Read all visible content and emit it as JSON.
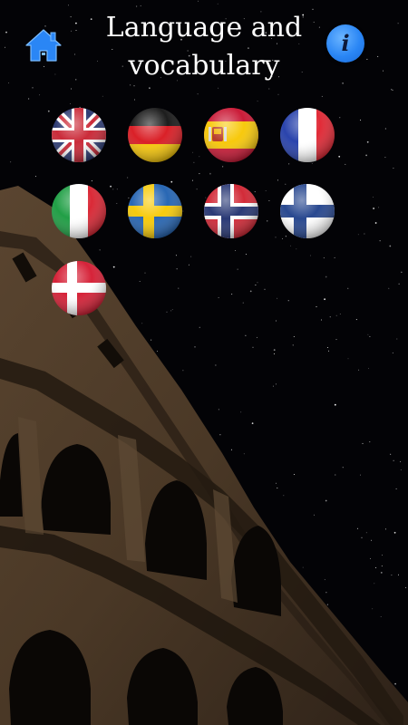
{
  "header": {
    "title": "Language and vocabulary",
    "title_line1": "Language and",
    "title_line2": "vocabulary",
    "home_icon": "home-icon",
    "info_icon": "info-icon",
    "info_glyph": "i",
    "accent_color": "#2a86f5"
  },
  "languages": [
    {
      "flag": "united-kingdom"
    },
    {
      "flag": "germany"
    },
    {
      "flag": "spain"
    },
    {
      "flag": "france"
    },
    {
      "flag": "italy"
    },
    {
      "flag": "sweden"
    },
    {
      "flag": "norway"
    },
    {
      "flag": "finland"
    },
    {
      "flag": "denmark"
    }
  ]
}
